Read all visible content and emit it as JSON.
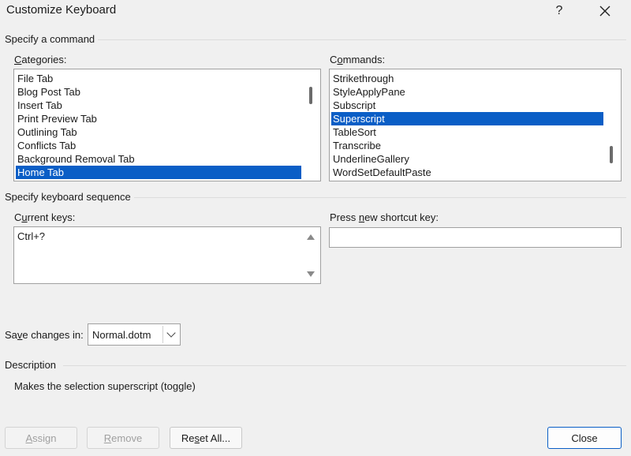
{
  "window": {
    "title": "Customize Keyboard",
    "help_label": "?",
    "close_glyph": "✕"
  },
  "specify_command": {
    "group_label": "Specify a command",
    "categories": {
      "label_prefix": "",
      "label_accel": "C",
      "label_rest": "ategories:",
      "items": [
        "File Tab",
        "Blog Post Tab",
        "Insert Tab",
        "Print Preview Tab",
        "Outlining Tab",
        "Conflicts Tab",
        "Background Removal Tab",
        "Home Tab"
      ],
      "selected": "Home Tab"
    },
    "commands": {
      "label_prefix": "C",
      "label_accel": "o",
      "label_rest": "mmands:",
      "items": [
        "Strikethrough",
        "StyleApplyPane",
        "Subscript",
        "Superscript",
        "TableSort",
        "Transcribe",
        "UnderlineGallery",
        "WordSetDefaultPaste"
      ],
      "selected": "Superscript"
    }
  },
  "keyboard_sequence": {
    "group_label": "Specify keyboard sequence",
    "current_keys": {
      "label_prefix": "C",
      "label_accel": "u",
      "label_rest": "rrent keys:",
      "items": [
        "Ctrl+?"
      ]
    },
    "new_shortcut": {
      "label_prefix": "Press ",
      "label_accel": "n",
      "label_rest": "ew shortcut key:",
      "value": ""
    }
  },
  "save_changes": {
    "label_prefix": "Sa",
    "label_accel": "v",
    "label_rest": "e changes in:",
    "value": "Normal.dotm"
  },
  "description": {
    "group_label": "Description",
    "text": "Makes the selection superscript (toggle)"
  },
  "buttons": {
    "assign": {
      "label_prefix": "",
      "label_accel": "A",
      "label_rest": "ssign"
    },
    "remove": {
      "label_prefix": "",
      "label_accel": "R",
      "label_rest": "emove"
    },
    "reset_all": {
      "label_prefix": "Re",
      "label_accel": "s",
      "label_rest": "et All..."
    },
    "close": {
      "label": "Close"
    }
  }
}
